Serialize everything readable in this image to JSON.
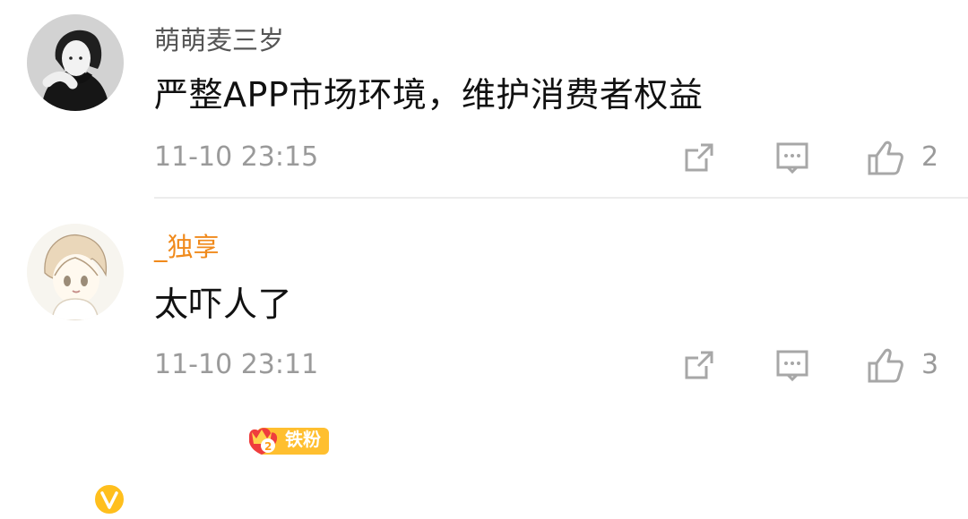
{
  "comments": [
    {
      "username": "萌萌麦三岁",
      "text": "严整APP市场环境，维护消费者权益",
      "time": "11-10 23:15",
      "likes": "2",
      "icons": {
        "avatar": "portrait-avatar",
        "share": "share-icon",
        "reply": "reply-icon",
        "like": "thumbs-up-icon"
      }
    },
    {
      "username": "_独享",
      "badge": "铁粉",
      "text": "太吓人了",
      "time": "11-10 23:11",
      "likes": "3",
      "icons": {
        "avatar": "cartoon-avatar",
        "verified": "verified-badge-icon",
        "fan_badge": "crown-badge-icon",
        "share": "share-icon",
        "reply": "reply-icon",
        "like": "thumbs-up-icon"
      }
    }
  ],
  "colors": {
    "username_1": "#555555",
    "username_2": "#f08a1c",
    "time": "#9a9a9a",
    "badge": "#ffbf2f"
  }
}
